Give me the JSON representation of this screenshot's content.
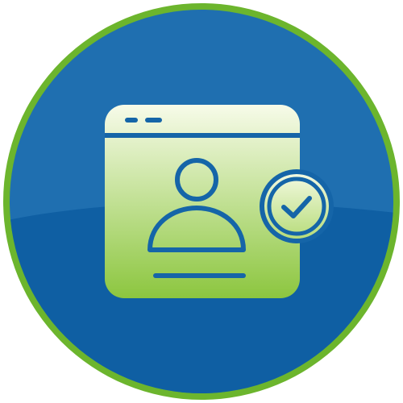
{
  "icon": {
    "name": "verified-user-profile-icon",
    "elements": [
      "browser-window-icon",
      "user-avatar-icon",
      "checkmark-badge-icon"
    ]
  },
  "colors": {
    "ring": "#6cb52d",
    "disc_light": "#1f6fb0",
    "disc_dark": "#0f5fa3",
    "window_top": "#f7fbe9",
    "window_bottom": "#8cc63f",
    "stroke": "#1565a8"
  }
}
